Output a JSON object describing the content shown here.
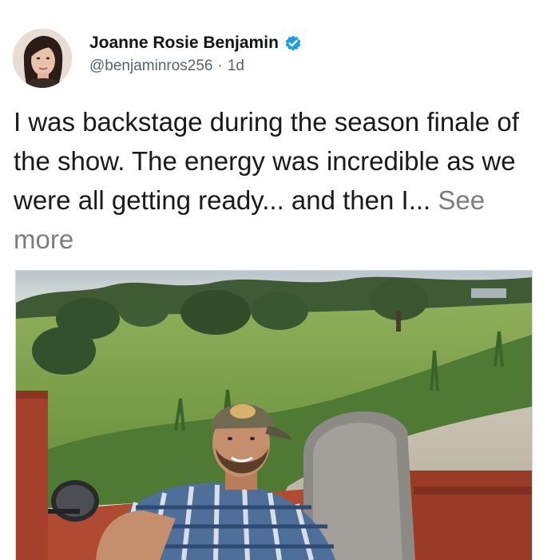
{
  "tweet": {
    "author": {
      "display_name": "Joanne Rosie Benjamin",
      "handle": "@benjaminros256",
      "verified": true,
      "avatar_icon": "avatar-photo"
    },
    "separator": "·",
    "age": "1d",
    "text": "I was backstage during the season finale of the show. The energy was incredible as we were all getting ready... and then I...",
    "see_more_label": "See more",
    "media": {
      "type": "photo",
      "description_icon": "photo-man-in-red-truck"
    }
  },
  "colors": {
    "verified_blue": "#1d9bf0",
    "secondary_text": "#536471",
    "see_more_gray": "#7d7d7d"
  }
}
